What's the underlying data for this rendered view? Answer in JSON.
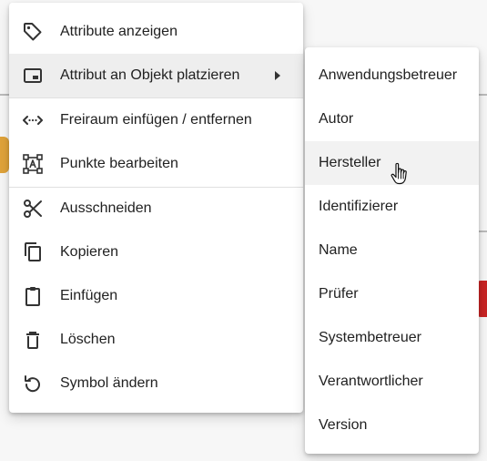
{
  "main_menu": {
    "items": [
      {
        "label": "Attribute anzeigen",
        "icon": "tag-icon"
      },
      {
        "label": "Attribut an Objekt platzieren",
        "icon": "picture-in-picture-icon",
        "has_submenu": true
      },
      {
        "label": "Freiraum einfügen / entfernen",
        "icon": "horizontal-space-icon"
      },
      {
        "label": "Punkte bearbeiten",
        "icon": "edit-points-icon"
      },
      {
        "label": "Ausschneiden",
        "icon": "scissors-icon"
      },
      {
        "label": "Kopieren",
        "icon": "copy-icon"
      },
      {
        "label": "Einfügen",
        "icon": "clipboard-icon"
      },
      {
        "label": "Löschen",
        "icon": "trash-icon"
      },
      {
        "label": "Symbol ändern",
        "icon": "undo-icon"
      }
    ]
  },
  "sub_menu": {
    "items": [
      {
        "label": "Anwendungsbetreuer"
      },
      {
        "label": "Autor"
      },
      {
        "label": "Hersteller"
      },
      {
        "label": "Identifizierer"
      },
      {
        "label": "Name"
      },
      {
        "label": "Prüfer"
      },
      {
        "label": "Systembetreuer"
      },
      {
        "label": "Verantwortlicher"
      },
      {
        "label": "Version"
      }
    ],
    "hovered": "Hersteller"
  },
  "colors": {
    "menu_bg": "#ffffff",
    "active_bg": "#eeeeee",
    "text": "#212121"
  }
}
